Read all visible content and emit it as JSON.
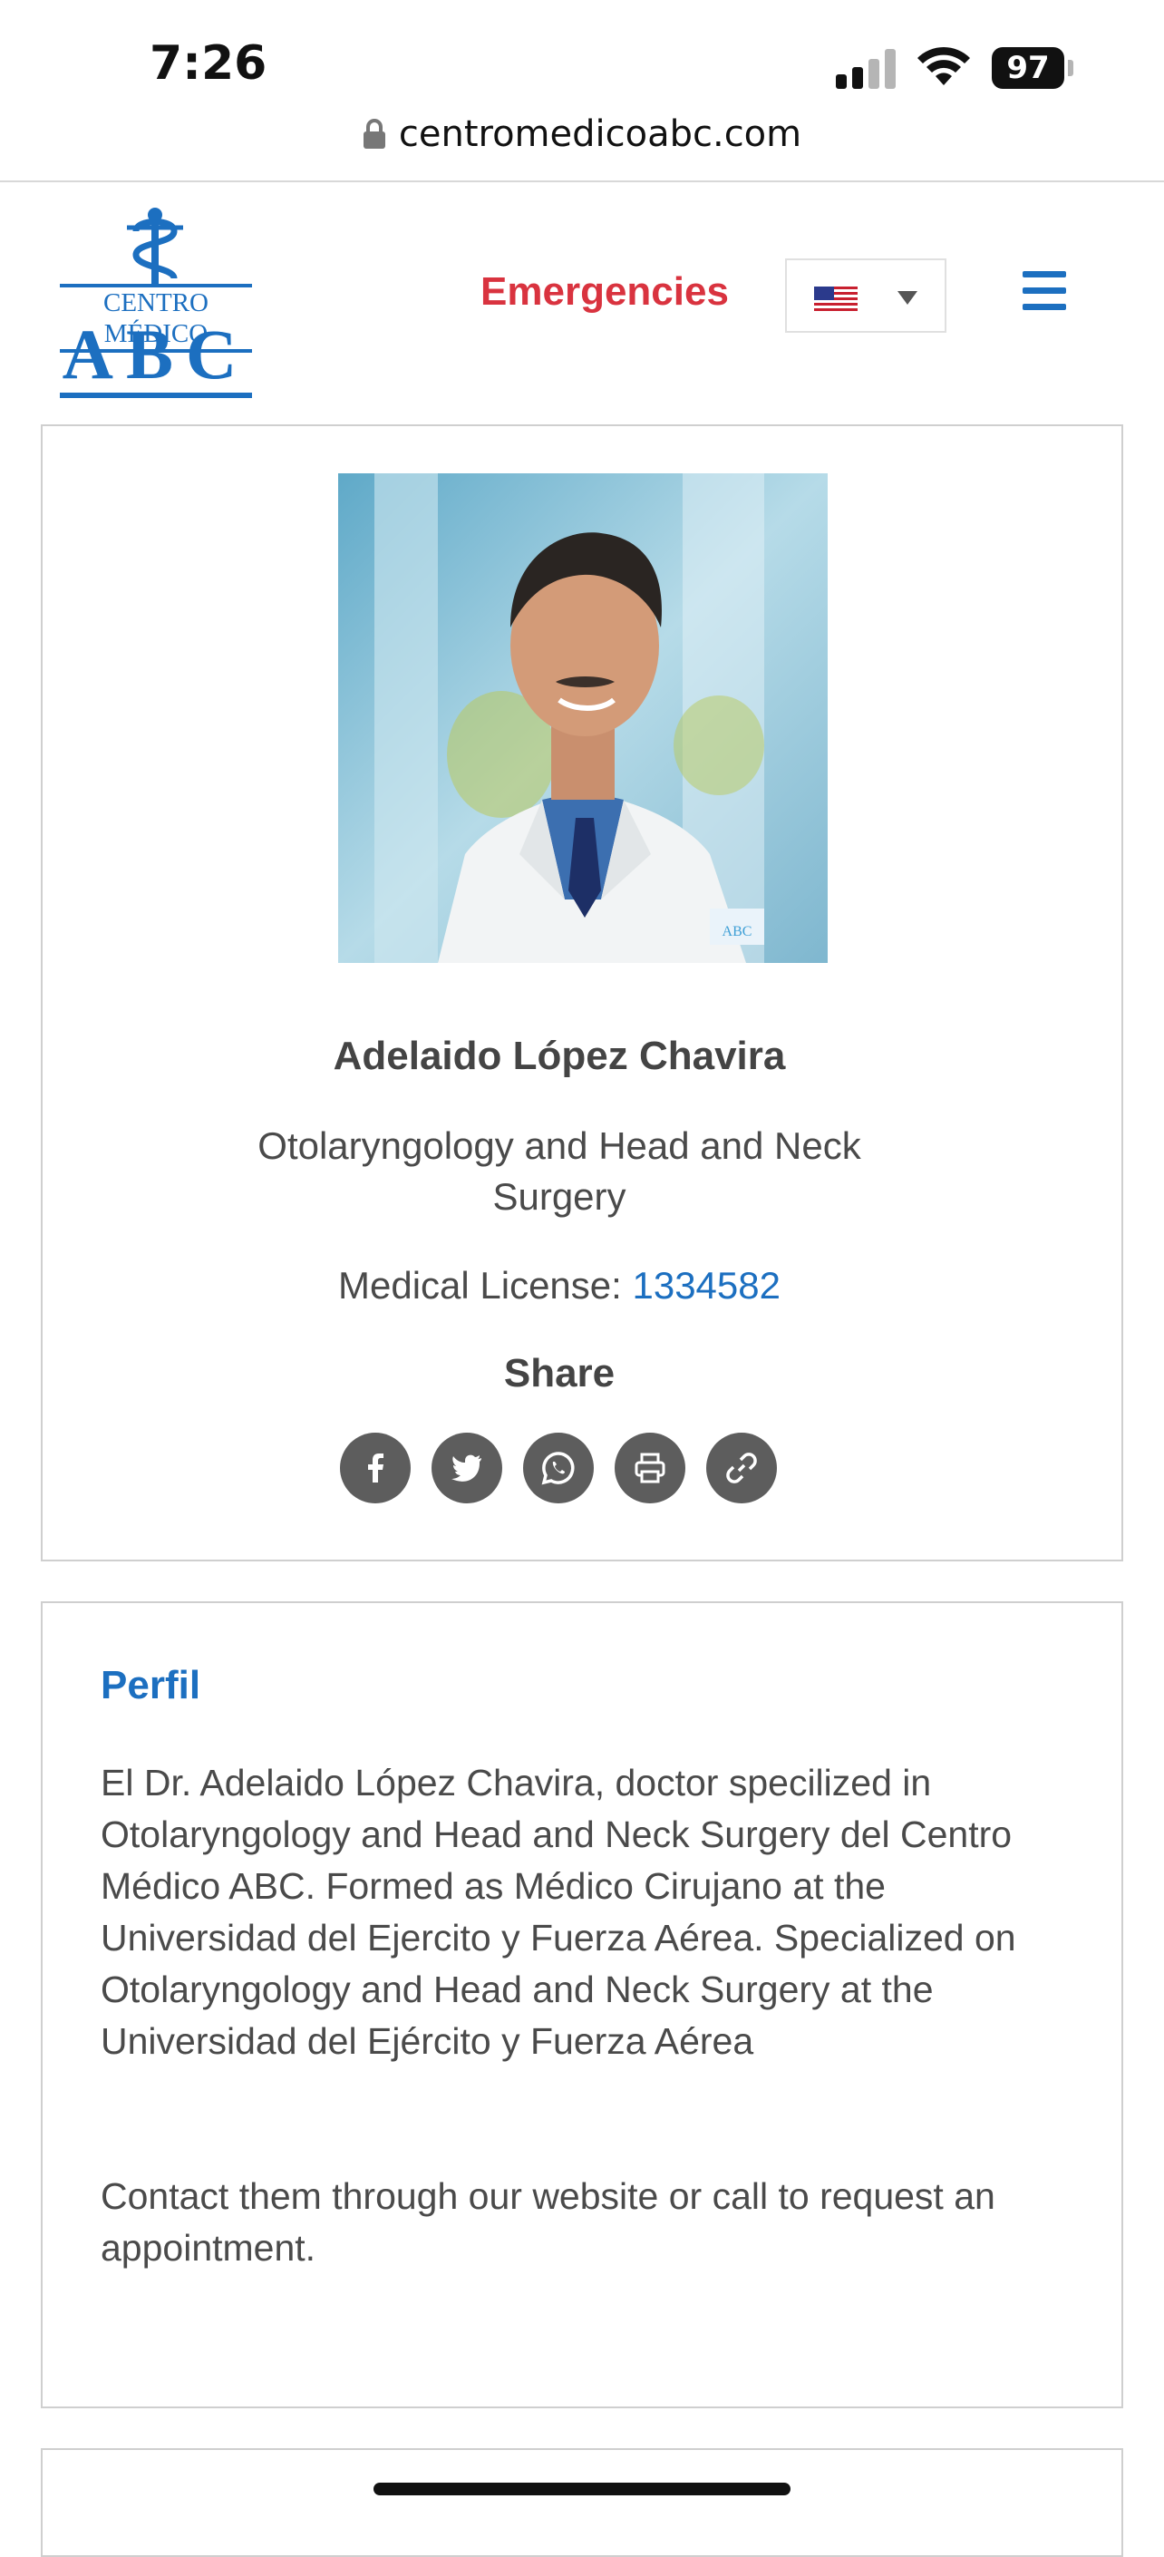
{
  "status_bar": {
    "time": "7:26",
    "battery": "97",
    "icons": [
      "signal-icon",
      "wifi-icon",
      "battery-icon"
    ]
  },
  "browser": {
    "url": "centromedicoabc.com",
    "lock_icon": "lock-icon"
  },
  "header": {
    "logo_line1": "CENTRO MÉDICO",
    "logo_line2": "ABC",
    "emergencies": "Emergencies",
    "language_flag": "us-flag-icon",
    "menu_icon": "hamburger-menu-icon"
  },
  "doctor": {
    "name": "Adelaido López Chavira",
    "specialty": "Otolaryngology and Head and Neck Surgery",
    "license_label": "Medical License: ",
    "license_number": "1334582",
    "share_label": "Share",
    "share_icons": [
      "facebook-icon",
      "twitter-icon",
      "whatsapp-icon",
      "print-icon",
      "link-icon"
    ]
  },
  "profile": {
    "title": "Perfil",
    "body": "El Dr. Adelaido López Chavira, doctor specilized in Otolaryngology and Head and Neck Surgery del Centro Médico ABC. Formed as Médico Cirujano at the Universidad del Ejercito y Fuerza Aérea. Specialized on Otolaryngology and Head and Neck Surgery at the Universidad del Ejército y Fuerza Aérea",
    "contact": "Contact them through our website or call to request an appointment."
  },
  "colors": {
    "brand_blue": "#1c6fc0",
    "emergency_red": "#d9333f",
    "icon_gray": "#5d5d5d"
  }
}
